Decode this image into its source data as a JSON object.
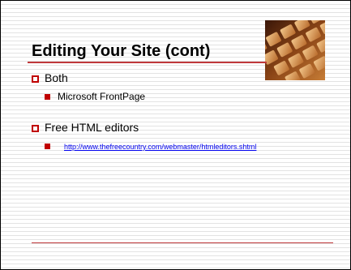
{
  "slide": {
    "title": "Editing Your Site (cont)",
    "items": [
      {
        "level": 1,
        "text": "Both"
      },
      {
        "level": 2,
        "text": "Microsoft FrontPage"
      },
      {
        "level": 1,
        "text": "Free HTML editors"
      },
      {
        "level": 2,
        "text": "http://www.thefreecountry.com/webmaster/htmleditors.shtml",
        "is_link": true
      }
    ],
    "accent_color": "#c00000",
    "rule_color": "#c0393b",
    "link_color": "#0000ee",
    "image": "keyboard-keys-photo"
  }
}
